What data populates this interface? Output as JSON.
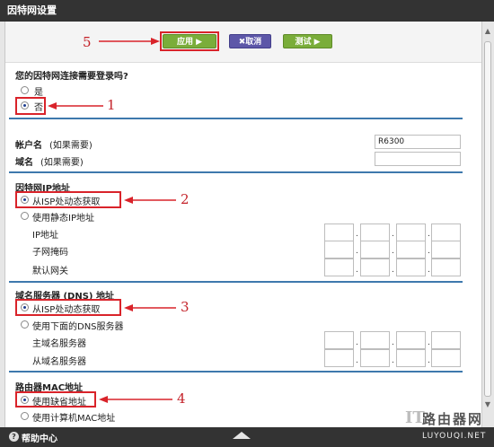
{
  "window": {
    "title": "因特网设置"
  },
  "toolbar": {
    "apply_label": "应用 ▶",
    "cancel_label": "✖取消",
    "test_label": "测试 ▶"
  },
  "login_question": {
    "label": "您的因特网连接需要登录吗?",
    "options": [
      "是",
      "否"
    ],
    "selected": "否"
  },
  "account": {
    "name_label": "帐户名",
    "name_hint": "(如果需要)",
    "name_value": "R6300",
    "domain_label": "域名",
    "domain_hint": "(如果需要)",
    "domain_value": ""
  },
  "ip_section": {
    "title": "因特网IP地址",
    "option_dynamic": "从ISP处动态获取",
    "option_static": "使用静态IP地址",
    "selected": "从ISP处动态获取",
    "ip_label": "IP地址",
    "subnet_label": "子网掩码",
    "gateway_label": "默认网关"
  },
  "dns_section": {
    "title": "域名服务器 (DNS) 地址",
    "option_dynamic": "从ISP处动态获取",
    "option_manual": "使用下面的DNS服务器",
    "selected": "从ISP处动态获取",
    "primary_label": "主域名服务器",
    "secondary_label": "从域名服务器"
  },
  "mac_section": {
    "title": "路由器MAC地址",
    "option_default": "使用缺省地址",
    "option_computer": "使用计算机MAC地址",
    "selected": "使用缺省地址"
  },
  "annotations": {
    "n1": "1",
    "n2": "2",
    "n3": "3",
    "n4": "4",
    "n5": "5",
    "color": "#d9232a"
  },
  "footer": {
    "help_label": "帮助中心",
    "help_icon": "question-mark-icon"
  },
  "watermark": {
    "it": "IT",
    "site": "路由器网",
    "url": "LUYOUQI.NET"
  }
}
